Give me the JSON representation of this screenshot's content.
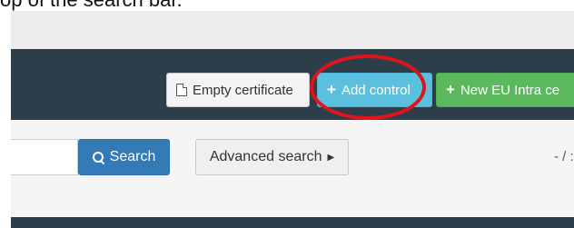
{
  "caption": {
    "text": "op of the search bar."
  },
  "toolbar": {
    "empty_certificate_label": "Empty certificate",
    "add_control_label": "Add control",
    "new_eu_intra_label": "New EU Intra ce"
  },
  "search": {
    "button_label": "Search",
    "advanced_label": "Advanced search",
    "pager_text": "- / :"
  },
  "icons": {
    "empty_certificate": "document-icon",
    "add_control": "plus-icon",
    "new_eu_intra": "plus-icon",
    "search": "magnifier-icon",
    "advanced": "caret-right-icon"
  },
  "colors": {
    "header": "#2c3e4a",
    "add_control": "#5bc0de",
    "new_eu_intra": "#5cb85c",
    "search_button": "#337ab7",
    "highlight": "#e3131b"
  }
}
